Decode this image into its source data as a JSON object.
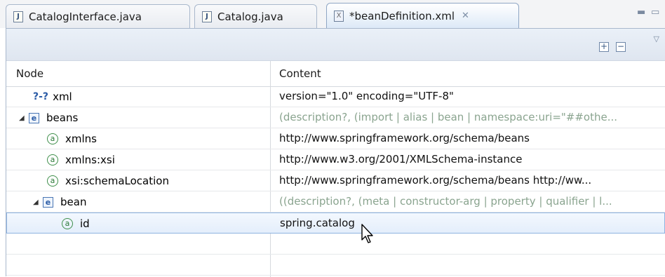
{
  "tabs": [
    {
      "label": "CatalogInterface.java",
      "icon": "java-file-icon"
    },
    {
      "label": "Catalog.java",
      "icon": "java-file-icon"
    },
    {
      "label": "*beanDefinition.xml",
      "icon": "xml-file-icon",
      "active": true
    }
  ],
  "tab_icon_glyphs": {
    "java": "J",
    "xml": "X"
  },
  "window_controls": {
    "minimize": "▭",
    "maximize": "▭"
  },
  "toolbar": {
    "expand_all": "+",
    "collapse_all": "−",
    "menu": "▽"
  },
  "table": {
    "headers": {
      "node": "Node",
      "content": "Content"
    },
    "rows": [
      {
        "type": "pi",
        "icon_glyph": "?-?",
        "name": "xml",
        "content": "version=\"1.0\" encoding=\"UTF-8\"",
        "muted": false
      },
      {
        "type": "element",
        "icon_glyph": "e",
        "name": "beans",
        "content": "(description?, (import | alias | bean | namespace:uri=\"##othe...",
        "muted": true,
        "expanded": true
      },
      {
        "type": "attribute",
        "icon_glyph": "a",
        "name": "xmlns",
        "content": "http://www.springframework.org/schema/beans",
        "muted": false
      },
      {
        "type": "attribute",
        "icon_glyph": "a",
        "name": "xmlns:xsi",
        "content": "http://www.w3.org/2001/XMLSchema-instance",
        "muted": false
      },
      {
        "type": "attribute",
        "icon_glyph": "a",
        "name": "xsi:schemaLocation",
        "content": "http://www.springframework.org/schema/beans http://ww...",
        "muted": false
      },
      {
        "type": "element",
        "icon_glyph": "e",
        "name": "bean",
        "content": "((description?, (meta | constructor-arg | property | qualifier | l...",
        "muted": true,
        "expanded": true
      },
      {
        "type": "attribute",
        "icon_glyph": "a",
        "name": "id",
        "content": "spring.catalog",
        "muted": false,
        "selected": true
      }
    ]
  },
  "colors": {
    "accent": "#8fb3e0",
    "muted_text": "#8aa48f",
    "attribute_icon": "#2b7a37",
    "element_icon": "#2a5ba6"
  }
}
